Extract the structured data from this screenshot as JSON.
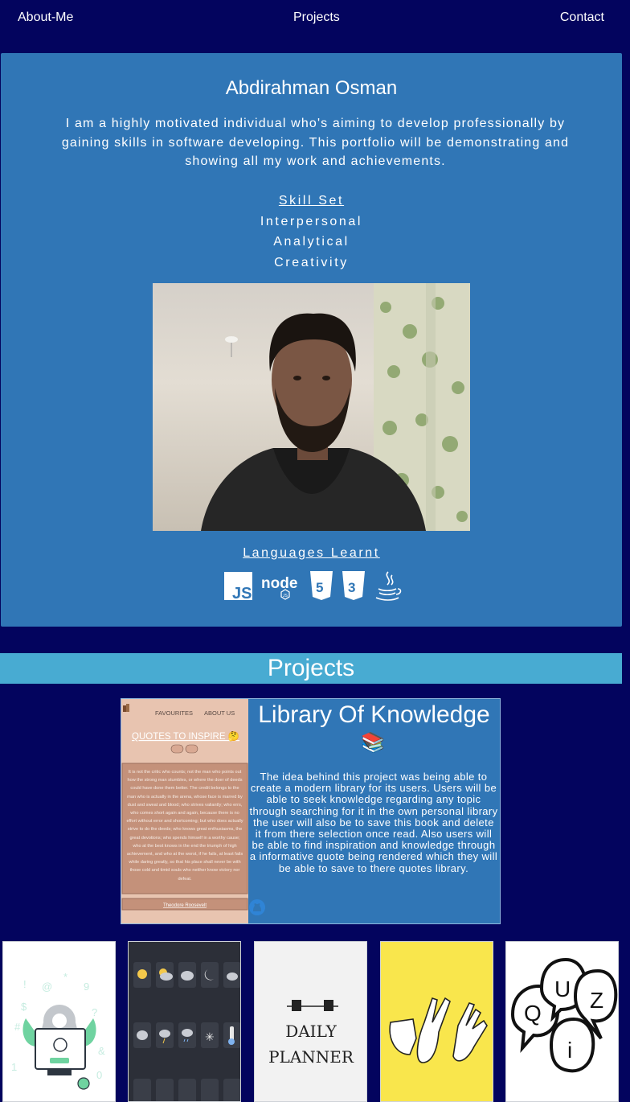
{
  "nav": {
    "about": "About-Me",
    "projects": "Projects",
    "contact": "Contact"
  },
  "about": {
    "name": "Abdirahman Osman",
    "bio": "I am a highly motivated individual who's aiming to develop professionally by gaining skills in software developing. This portfolio will be demonstrating and showing all my work and achievements.",
    "skills_heading": "Skill Set",
    "skills": [
      "Interpersonal",
      "Analytical",
      "Creativity"
    ],
    "languages_heading": "Languages Learnt",
    "languages": [
      "javascript-icon",
      "nodejs-icon",
      "html5-icon",
      "css3-icon",
      "java-icon"
    ]
  },
  "projects": {
    "heading": "Projects",
    "featured": {
      "title": "Library Of Knowledge",
      "emoji": "📚",
      "description": "The idea behind this project was being able to create a modern library for its users. Users will be able to seek knowledge regarding any topic through searching for it in the own personal library the user will also be to save this book and delete it from there selection once read. Also users will be able to find inspiration and knowledge through a informative quote being rendered which they will be able to save to there quotes library.",
      "screenshot": {
        "nav_favourites": "FAVOURITES",
        "nav_about": "ABOUT US",
        "heading": "QUOTES TO INSPIRE 🤔",
        "quote": "It is not the critic who counts; not the man who points out how the strong man stumbles, or where the doer of deeds could have done them better. The credit belongs to the man who is actually in the arena, whose face is marred by dust and sweat and blood; who strives valiantly; who errs, who comes short again and again, because there is no effort without error and shortcoming; but who does actually strive to do the deeds; who knows great enthusiasms, the great devotions; who spends himself in a worthy cause; who at the best knows in the end the triumph of high achievement, and who at the worst, if he fails, at least fails while daring greatly, so that his place shall never be with those cold and timid souls who neither know victory nor defeat.",
        "author": "Theodore Roosevelt"
      }
    },
    "thumbnails": [
      {
        "name": "password-generator-thumbnail"
      },
      {
        "name": "weather-dashboard-thumbnail"
      },
      {
        "name": "daily-planner-thumbnail",
        "text_line1": "DAILY",
        "text_line2": "PLANNER"
      },
      {
        "name": "rock-paper-scissors-thumbnail"
      },
      {
        "name": "quiz-thumbnail",
        "letters": [
          "Q",
          "U",
          "i",
          "Z"
        ]
      }
    ]
  },
  "colors": {
    "background": "#03045e",
    "card": "#3076b6",
    "banner": "#48abd2"
  }
}
